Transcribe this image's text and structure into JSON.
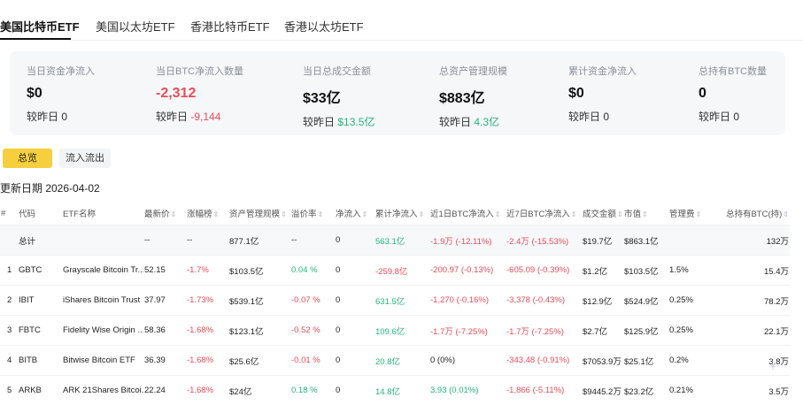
{
  "tabs": [
    "美国比特币ETF",
    "美国以太坊ETF",
    "香港比特币ETF",
    "香港以太坊ETF"
  ],
  "stats": [
    {
      "label": "当日资金净流入",
      "value": "$0",
      "value_tone": "",
      "cmp_prefix": "较昨日 ",
      "cmp_value": "0",
      "cmp_tone": ""
    },
    {
      "label": "当日BTC净流入数量",
      "value": "-2,312",
      "value_tone": "neg",
      "cmp_prefix": "较昨日 ",
      "cmp_value": "-9,144",
      "cmp_tone": "neg"
    },
    {
      "label": "当日总成交金额",
      "value": "$33亿",
      "value_tone": "",
      "cmp_prefix": "较昨日 ",
      "cmp_value": "$13.5亿",
      "cmp_tone": "pos"
    },
    {
      "label": "总资产管理规模",
      "value": "$883亿",
      "value_tone": "",
      "cmp_prefix": "较昨日 ",
      "cmp_value": "4.3亿",
      "cmp_tone": "pos"
    },
    {
      "label": "累计资金净流入",
      "value": "$0",
      "value_tone": "",
      "cmp_prefix": "较昨日 ",
      "cmp_value": "0",
      "cmp_tone": ""
    },
    {
      "label": "总持有BTC数量",
      "value": "0",
      "value_tone": "",
      "cmp_prefix": "较昨日 ",
      "cmp_value": "0",
      "cmp_tone": ""
    }
  ],
  "buttons": {
    "overview": "总览",
    "flows": "流入流出"
  },
  "update_date": "更新日期 2026-04-02",
  "table": {
    "headers": [
      "#",
      "代码",
      "ETF名称",
      "最新价",
      "涨幅榜",
      "资产管理规模",
      "溢价率",
      "净流入",
      "累计净流入",
      "近1日BTC净流入",
      "近7日BTC净流入",
      "成交金额",
      "市值",
      "管理费",
      "总持有BTC(持)"
    ],
    "total_row": [
      "",
      "总计",
      "",
      "--",
      "--",
      "877.1亿",
      "--",
      "0",
      "563.1亿",
      "-1.9万 (-12.11%)",
      "-2.4万 (-15.53%)",
      "$19.7亿",
      "$863.1亿",
      "",
      "132万"
    ],
    "rows": [
      [
        "1",
        "GBTC",
        "Grayscale Bitcoin Tr...",
        "52.15",
        "-1.7%",
        "$103.5亿",
        "0.04 %",
        "0",
        "-259.8亿",
        "-200.97 (-0.13%)",
        "-605.09 (-0.39%)",
        "$1.2亿",
        "$103.5亿",
        "1.5%",
        "15.4万"
      ],
      [
        "2",
        "IBIT",
        "iShares Bitcoin Trust",
        "37.97",
        "-1.73%",
        "$539.1亿",
        "-0.07 %",
        "0",
        "631.5亿",
        "-1,270 (-0.16%)",
        "-3,378 (-0.43%)",
        "$12.9亿",
        "$524.9亿",
        "0.25%",
        "78.2万"
      ],
      [
        "3",
        "FBTC",
        "Fidelity Wise Origin ...",
        "58.36",
        "-1.68%",
        "$123.1亿",
        "-0.52 %",
        "0",
        "109.6亿",
        "-1.7万 (-7.25%)",
        "-1.7万 (-7.25%)",
        "$2.7亿",
        "$125.9亿",
        "0.25%",
        "22.1万"
      ],
      [
        "4",
        "BITB",
        "Bitwise Bitcoin ETF",
        "36.39",
        "-1.68%",
        "$25.6亿",
        "-0.01 %",
        "0",
        "20.8亿",
        "0 (0%)",
        "-343.48 (-0.91%)",
        "$7053.9万",
        "$25.1亿",
        "0.2%",
        "3.8万"
      ],
      [
        "5",
        "ARKB",
        "ARK 21Shares Bitcoi...",
        "22.24",
        "-1.68%",
        "$24亿",
        "0.18 %",
        "0",
        "14.8亿",
        "3.93 (0.01%)",
        "-1,866 (-5.11%)",
        "$9445.2万",
        "$23.2亿",
        "0.21%",
        "3.5万"
      ]
    ],
    "tones": [
      [
        "",
        "",
        "",
        "",
        "",
        "",
        "",
        "",
        "pos",
        "neg",
        "neg",
        "",
        "",
        "",
        ""
      ],
      [
        "",
        "",
        "",
        "",
        "neg",
        "",
        "pos",
        "",
        "neg",
        "neg",
        "neg",
        "",
        "",
        "",
        ""
      ],
      [
        "",
        "",
        "",
        "",
        "neg",
        "",
        "neg",
        "",
        "pos",
        "neg",
        "neg",
        "",
        "",
        "",
        ""
      ],
      [
        "",
        "",
        "",
        "",
        "neg",
        "",
        "neg",
        "",
        "pos",
        "neg",
        "neg",
        "",
        "",
        "",
        ""
      ],
      [
        "",
        "",
        "",
        "",
        "neg",
        "",
        "neg",
        "",
        "pos",
        "",
        "neg",
        "",
        "",
        "",
        ""
      ],
      [
        "",
        "",
        "",
        "",
        "neg",
        "",
        "pos",
        "",
        "pos",
        "pos",
        "neg",
        "",
        "",
        "",
        ""
      ]
    ]
  },
  "colors": {
    "accent": "#f5cf3d",
    "positive": "#21b57a",
    "negative": "#e84c5a",
    "panel": "#f6f7f9"
  }
}
